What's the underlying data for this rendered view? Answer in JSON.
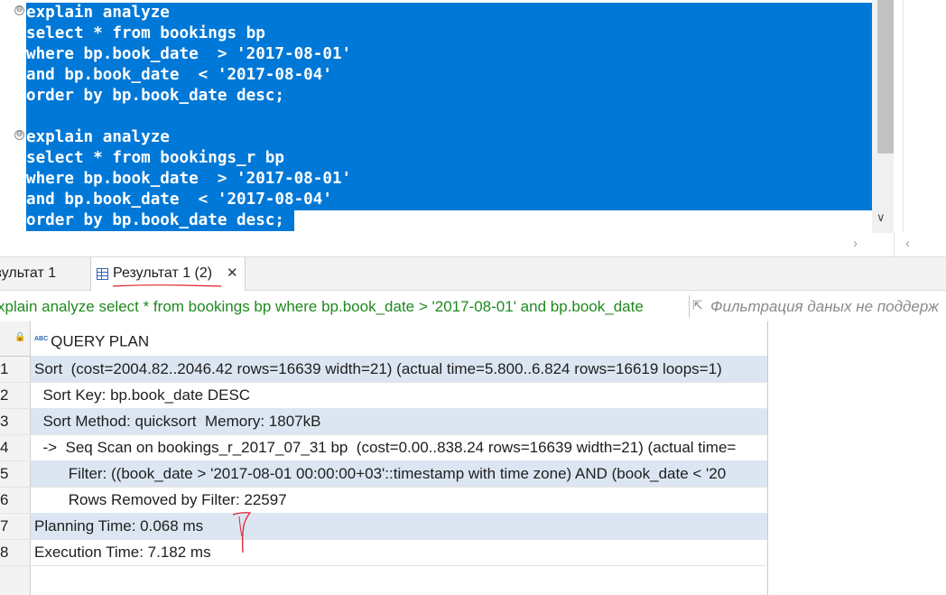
{
  "editor": {
    "lines": [
      "explain analyze",
      "select * from bookings bp",
      "where bp.book_date  > '2017-08-01'",
      "and bp.book_date  < '2017-08-04'",
      "order by bp.book_date desc;",
      "",
      "explain analyze",
      "select * from bookings_r bp",
      "where bp.book_date  > '2017-08-01'",
      "and bp.book_date  < '2017-08-04'",
      "order by bp.book_date desc;"
    ],
    "fold_marker": "⊖",
    "selection_color": "#0078d7"
  },
  "tabs": [
    {
      "label": "езультат 1"
    },
    {
      "label": "Результат 1 (2)",
      "close": "✕",
      "icon": "grid-icon"
    }
  ],
  "filter": {
    "query": "xplain analyze select * from bookings bp where bp.book_date > '2017-08-01' and bp.book_date",
    "hint": "Фильтрация даных не поддерж",
    "query_color": "#1e8a1e"
  },
  "grid": {
    "column_badge": "ABC",
    "column": "QUERY PLAN",
    "rows": [
      {
        "n": "1",
        "text": "Sort  (cost=2004.82..2046.42 rows=16639 width=21) (actual time=5.800..6.824 rows=16619 loops=1)"
      },
      {
        "n": "2",
        "text": "  Sort Key: bp.book_date DESC"
      },
      {
        "n": "3",
        "text": "  Sort Method: quicksort  Memory: 1807kB"
      },
      {
        "n": "4",
        "text": "  ->  Seq Scan on bookings_r_2017_07_31 bp  (cost=0.00..838.24 rows=16639 width=21) (actual time="
      },
      {
        "n": "5",
        "text": "        Filter: ((book_date > '2017-08-01 00:00:00+03'::timestamp with time zone) AND (book_date < '20"
      },
      {
        "n": "6",
        "text": "        Rows Removed by Filter: 22597"
      },
      {
        "n": "7",
        "text": "Planning Time: 0.068 ms"
      },
      {
        "n": "8",
        "text": "Execution Time: 7.182 ms"
      }
    ],
    "alt_row_color": "#dce6f2"
  }
}
